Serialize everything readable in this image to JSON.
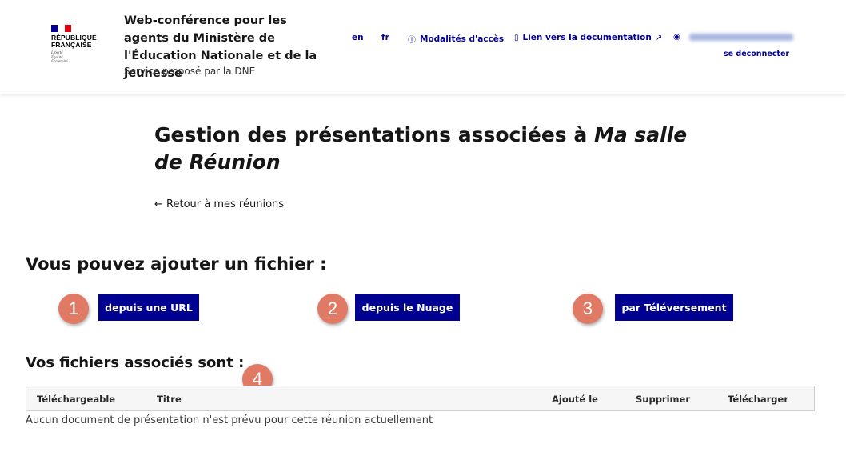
{
  "header": {
    "logo": {
      "line1": "RÉPUBLIQUE",
      "line2": "FRANÇAISE",
      "motto1": "Liberté",
      "motto2": "Égalité",
      "motto3": "Fraternité",
      "flag_colors": [
        "#000091",
        "#ffffff",
        "#e1000f"
      ]
    },
    "service_title": "Web-conférence pour les agents du Ministère de l'Éducation Nationale et de la Jeunesse",
    "service_subtitle": "Service proposé par la DNE",
    "lang_en": "en",
    "lang_fr": "fr",
    "access_link": {
      "icon": "info-icon",
      "label": "Modalités d'accès"
    },
    "doc_link": {
      "icon": "book-icon",
      "label": "Lien vers la documentation",
      "external_icon": "external-link-icon"
    },
    "user": {
      "icon": "user-icon"
    },
    "logout": "se déconnecter"
  },
  "main": {
    "title_prefix": "Gestion des présentations associées à ",
    "title_room": "Ma salle de Réunion",
    "back_link": "Retour à mes réunions",
    "add_heading": "Vous pouvez ajouter un fichier :",
    "add_buttons": [
      {
        "number": "1",
        "label": "depuis une URL"
      },
      {
        "number": "2",
        "label": "depuis le Nuage"
      },
      {
        "number": "3",
        "label": "par Téléversement"
      }
    ],
    "files_heading": "Vos fichiers associés sont :",
    "files_marker": "4",
    "table_headers": [
      "Téléchargeable",
      "Titre",
      "Ajouté le",
      "Supprimer",
      "Télécharger"
    ],
    "empty_message": "Aucun document de présentation n'est prévu pour cette réunion actuellement"
  },
  "colors": {
    "primary": "#000091",
    "marker": "#e07a65"
  }
}
